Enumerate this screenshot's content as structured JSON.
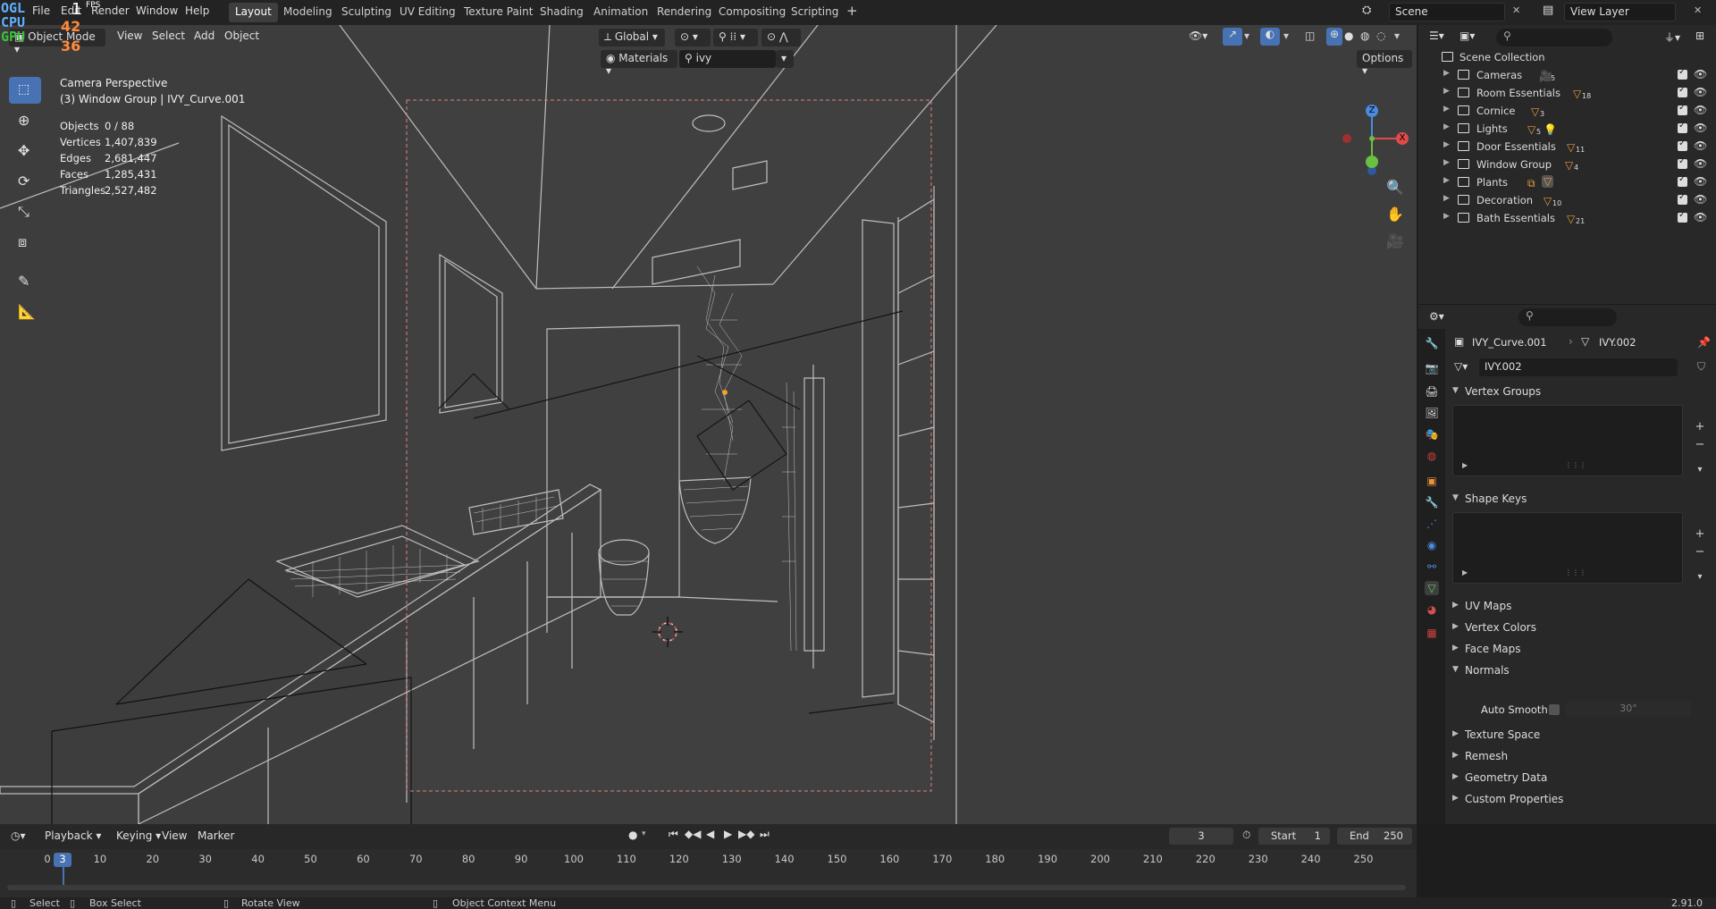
{
  "topbar": {
    "fps_overlay": {
      "ogl": "OGL",
      "cpu": "CPU",
      "gpu": "GPU",
      "fps_label": "FPS",
      "fps_value": "1",
      "value_42": "42",
      "value_36": "36"
    },
    "menus": [
      "File",
      "Edit",
      "Render",
      "Window",
      "Help"
    ],
    "workspaces": [
      "Layout",
      "Modeling",
      "Sculpting",
      "UV Editing",
      "Texture Paint",
      "Shading",
      "Animation",
      "Rendering",
      "Compositing",
      "Scripting"
    ],
    "active_workspace": "Layout",
    "add_tab": "+",
    "scene": "Scene",
    "view_layer": "View Layer"
  },
  "viewport": {
    "mode": "Object Mode",
    "menus": [
      "View",
      "Select",
      "Add",
      "Object"
    ],
    "transform_orientation": "Global",
    "material_filter": "Materials",
    "search_value": "ivy",
    "options_label": "Options",
    "overlay_title": "Camera Perspective",
    "overlay_subtitle": "(3) Window Group | IVY_Curve.001",
    "stats": [
      {
        "label": "Objects",
        "value": "0 / 88"
      },
      {
        "label": "Vertices",
        "value": "1,407,839"
      },
      {
        "label": "Edges",
        "value": "2,681,447"
      },
      {
        "label": "Faces",
        "value": "1,285,431"
      },
      {
        "label": "Triangles",
        "value": "2,527,482"
      }
    ],
    "gizmo": {
      "z": "Z",
      "x": "X",
      "y": "Y"
    }
  },
  "outliner": {
    "root": "Scene Collection",
    "items": [
      {
        "label": "Cameras",
        "count": "5"
      },
      {
        "label": "Room Essentials",
        "count": "18"
      },
      {
        "label": "Cornice",
        "count": "3"
      },
      {
        "label": "Lights",
        "count": "5"
      },
      {
        "label": "Door Essentials",
        "count": "11"
      },
      {
        "label": "Window Group",
        "count": "4"
      },
      {
        "label": "Plants",
        "count": ""
      },
      {
        "label": "Decoration",
        "count": "10"
      },
      {
        "label": "Bath Essentials",
        "count": "21"
      }
    ]
  },
  "properties": {
    "object_name": "IVY_Curve.001",
    "mesh_name": "IVY.002",
    "data_field": "IVY.002",
    "panels": {
      "vertex_groups": "Vertex Groups",
      "shape_keys": "Shape Keys",
      "uv_maps": "UV Maps",
      "vertex_colors": "Vertex Colors",
      "face_maps": "Face Maps",
      "normals": "Normals",
      "auto_smooth": "Auto Smooth",
      "auto_smooth_angle": "30°",
      "texture_space": "Texture Space",
      "remesh": "Remesh",
      "geometry_data": "Geometry Data",
      "custom_properties": "Custom Properties"
    }
  },
  "timeline": {
    "menus": [
      "Playback",
      "Keying",
      "View",
      "Marker"
    ],
    "current_frame": "3",
    "start_label": "Start",
    "start": "1",
    "end_label": "End",
    "end": "250",
    "ruler": [
      "0",
      "10",
      "20",
      "30",
      "40",
      "50",
      "60",
      "70",
      "80",
      "90",
      "100",
      "110",
      "120",
      "130",
      "140",
      "150",
      "160",
      "170",
      "180",
      "190",
      "200",
      "210",
      "220",
      "230",
      "240",
      "250"
    ]
  },
  "statusbar": {
    "select": "Select",
    "box_select": "Box Select",
    "rotate_view": "Rotate View",
    "context_menu": "Object Context Menu",
    "version": "2.91.0"
  }
}
